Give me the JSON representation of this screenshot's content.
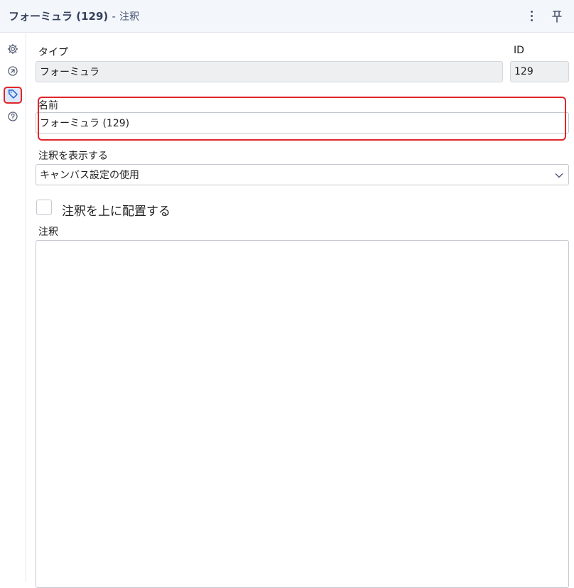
{
  "header": {
    "title": "フォーミュラ (129)",
    "separator": "-",
    "subtitle": "注釈"
  },
  "rail": {
    "icons": [
      "gear-icon",
      "workflow-icon",
      "tag-icon",
      "help-icon"
    ],
    "active": "tag-icon"
  },
  "form": {
    "type_label": "タイプ",
    "type_value": "フォーミュラ",
    "id_label": "ID",
    "id_value": "129",
    "name_label": "名前",
    "name_value": "フォーミュラ (129)",
    "show_annotation_label": "注釈を表示する",
    "show_annotation_value": "キャンバス設定の使用",
    "place_above_label": "注釈を上に配置する",
    "annotation_label": "注釈",
    "annotation_value": ""
  },
  "colors": {
    "highlight": "#e0262a",
    "header_bg": "#f3f6fb"
  }
}
